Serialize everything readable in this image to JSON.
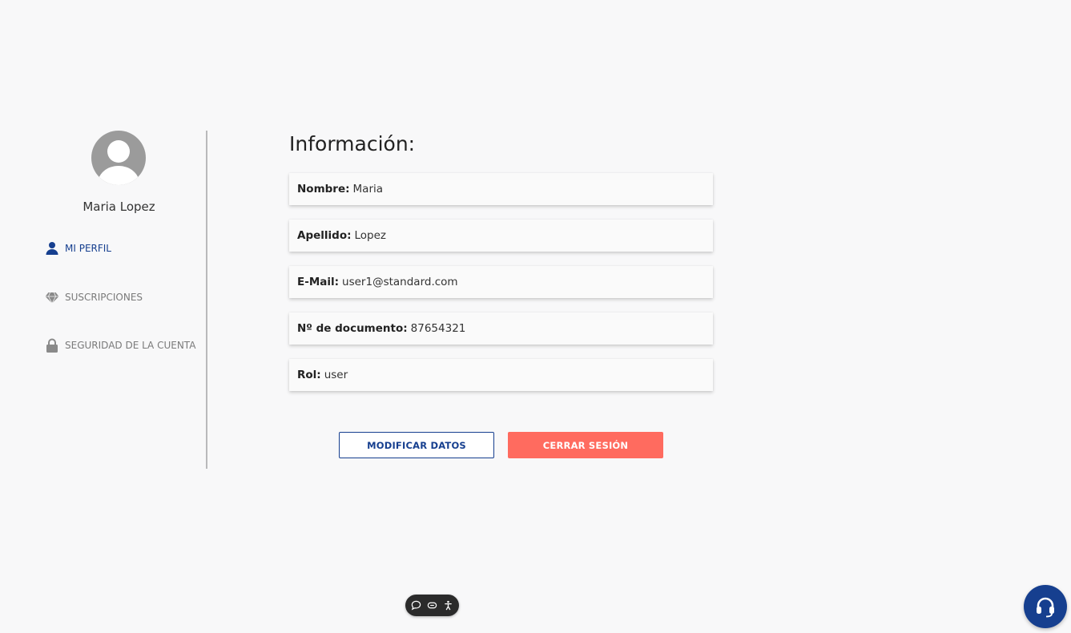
{
  "sidebar": {
    "user_name": "Maria Lopez",
    "items": [
      {
        "label": "MI PERFIL",
        "icon": "user-icon",
        "active": true
      },
      {
        "label": "SUSCRIPCIONES",
        "icon": "diamond-icon",
        "active": false
      },
      {
        "label": "SEGURIDAD DE LA CUENTA",
        "icon": "lock-icon",
        "active": false
      }
    ]
  },
  "main": {
    "title": "Información:",
    "fields": [
      {
        "label": "Nombre:",
        "value": "Maria"
      },
      {
        "label": "Apellido:",
        "value": "Lopez"
      },
      {
        "label": "E-Mail:",
        "value": "user1@standard.com"
      },
      {
        "label": "Nº de documento:",
        "value": "87654321"
      },
      {
        "label": "Rol:",
        "value": "user"
      }
    ],
    "buttons": {
      "modify_label": "MODIFICAR DATOS",
      "logout_label": "CERRAR SESIÓN"
    }
  },
  "colors": {
    "accent": "#163f8f",
    "danger": "#ff6b5f",
    "background": "#f8f8f9"
  },
  "a11y_toolbar": {
    "icons": [
      "speech-bubble-icon",
      "reading-mask-icon",
      "accessibility-icon"
    ]
  },
  "support": {
    "icon": "headset-icon"
  }
}
